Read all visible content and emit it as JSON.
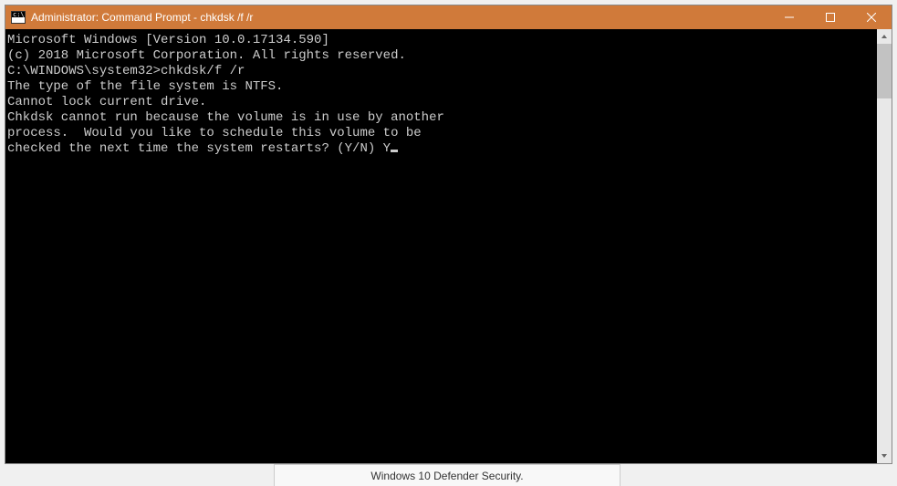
{
  "window": {
    "icon_label": "cmd",
    "title": "Administrator: Command Prompt - chkdsk /f /r"
  },
  "terminal": {
    "lines": [
      "Microsoft Windows [Version 10.0.17134.590]",
      "(c) 2018 Microsoft Corporation. All rights reserved.",
      "",
      "C:\\WINDOWS\\system32>chkdsk/f /r",
      "The type of the file system is NTFS.",
      "Cannot lock current drive.",
      "",
      "Chkdsk cannot run because the volume is in use by another",
      "process.  Would you like to schedule this volume to be",
      "checked the next time the system restarts? (Y/N) Y"
    ]
  },
  "taskbar": {
    "label": "Windows 10 Defender Security."
  }
}
